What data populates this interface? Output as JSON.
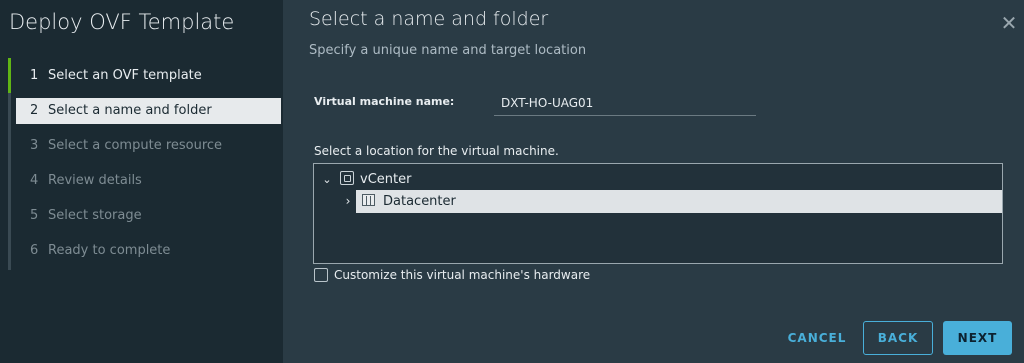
{
  "wizard": {
    "title": "Deploy OVF Template",
    "steps": [
      {
        "num": "1",
        "label": "Select an OVF template"
      },
      {
        "num": "2",
        "label": "Select a name and folder"
      },
      {
        "num": "3",
        "label": "Select a compute resource"
      },
      {
        "num": "4",
        "label": "Review details"
      },
      {
        "num": "5",
        "label": "Select storage"
      },
      {
        "num": "6",
        "label": "Ready to complete"
      }
    ]
  },
  "main": {
    "title": "Select a name and folder",
    "subtitle": "Specify a unique name and target location",
    "close_icon": "close-icon",
    "vm_name_label": "Virtual machine name:",
    "vm_name_value": "DXT-HO-UAG01",
    "location_label": "Select a location for the virtual machine.",
    "tree": {
      "root": {
        "label": "vCenter",
        "icon": "vcenter-icon",
        "expanded": true
      },
      "child": {
        "label": "Datacenter",
        "icon": "datacenter-icon",
        "selected": true
      }
    },
    "customize_hardware_label": "Customize this virtual machine's hardware",
    "customize_hardware_checked": false
  },
  "footer": {
    "cancel_label": "CANCEL",
    "back_label": "BACK",
    "next_label": "NEXT"
  },
  "colors": {
    "accent": "#49afd9",
    "step_done": "#60b515",
    "nav_bg": "#1b2a32",
    "content_bg": "#2a3b45"
  }
}
